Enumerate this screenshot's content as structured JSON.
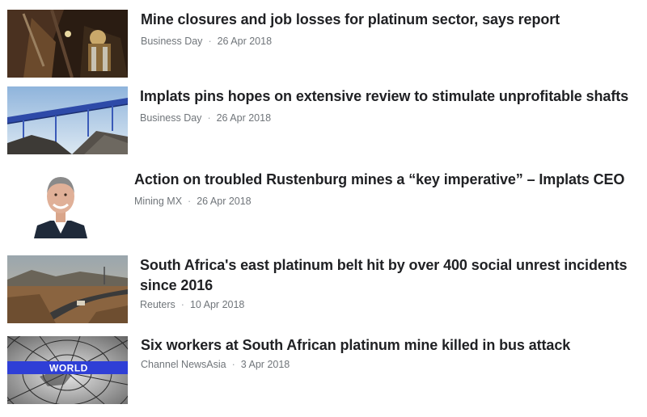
{
  "articles": [
    {
      "title": "Mine closures and job losses for platinum sector, says report",
      "source": "Business Day",
      "separator": "·",
      "date": "26 Apr 2018",
      "thumbnail": "underground-miner-image"
    },
    {
      "title": "Implats pins hopes on extensive review to stimulate unprofitable shafts",
      "source": "Business Day",
      "separator": "·",
      "date": "26 Apr 2018",
      "thumbnail": "conveyor-ore-pile-image"
    },
    {
      "title": "Action on troubled Rustenburg mines a “key imperative” – Implats CEO",
      "source": "Mining MX",
      "separator": "·",
      "date": "26 Apr 2018",
      "thumbnail": "ceo-portrait-image"
    },
    {
      "title": "South Africa's east platinum belt hit by over 400 social unrest incidents since 2016",
      "source": "Reuters",
      "separator": "·",
      "date": "10 Apr 2018",
      "thumbnail": "mining-road-landscape-image"
    },
    {
      "title": "Six workers at South African platinum mine killed in bus attack",
      "source": "Channel NewsAsia",
      "separator": "·",
      "date": "3 Apr 2018",
      "thumbnail": "world-news-globe-image",
      "thumbnail_text": "WORLD"
    }
  ],
  "colors": {
    "headline": "#202124",
    "meta": "#70757a",
    "world_banner": "#2f3fd6"
  }
}
